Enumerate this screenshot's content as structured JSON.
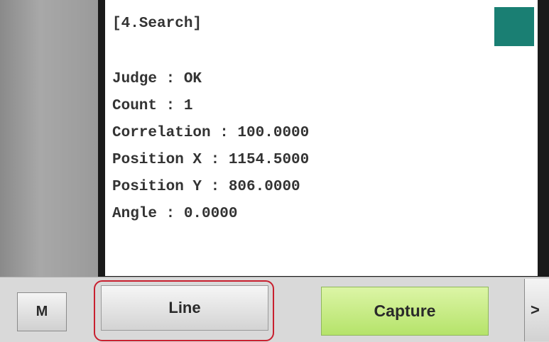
{
  "result": {
    "title": "[4.Search]",
    "lines": [
      "Judge : OK",
      "Count : 1",
      "Correlation : 100.0000",
      "Position X : 1154.5000",
      "Position Y : 806.0000",
      "Angle : 0.0000"
    ],
    "status_color": "#1a7f73"
  },
  "toolbar": {
    "m_label": "M",
    "line_label": "Line",
    "capture_label": "Capture",
    "next_label": ">",
    "highlight_color": "#c8202f",
    "capture_color": "#b5e36a"
  }
}
